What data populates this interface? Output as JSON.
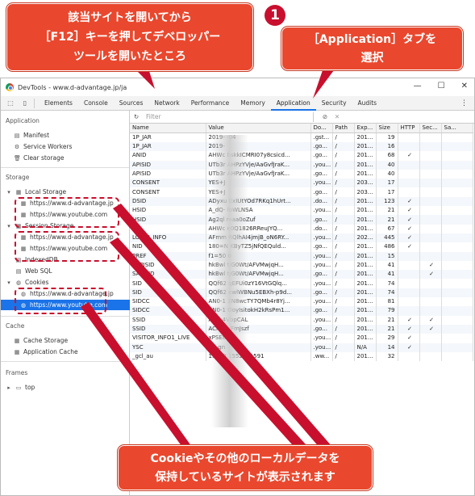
{
  "callout1": {
    "line1": "該当サイトを開いてから",
    "line2": "［F12］キーを押してデベロッパー",
    "line3": "ツールを開いたところ"
  },
  "badge": "1",
  "callout2": {
    "line1": "［Application］タブを",
    "line2": "選択"
  },
  "callout3": {
    "line1": "Cookieやその他のローカルデータを",
    "line2": "保持しているサイトが表示されます"
  },
  "window": {
    "title": "DevTools - www.d-advantage.jp/ja",
    "buttons": [
      "—",
      "☐",
      "✕"
    ]
  },
  "tabs": [
    "Elements",
    "Console",
    "Sources",
    "Network",
    "Performance",
    "Memory",
    "Application",
    "Security",
    "Audits"
  ],
  "active_tab": "Application",
  "sidebar": {
    "application_header": "Application",
    "manifest": "Manifest",
    "service_workers": "Service Workers",
    "clear_storage": "Clear storage",
    "storage_header": "Storage",
    "local_storage": "Local Storage",
    "local_items": [
      "https://www.d-advantage.jp",
      "https://www.youtube.com"
    ],
    "session_storage": "Session Storage",
    "session_items": [
      "https://www.d-advantage.jp",
      "https://www.youtube.com"
    ],
    "indexeddb": "IndexedDB",
    "websql": "Web SQL",
    "cookies": "Cookies",
    "cookie_items": [
      "https://www.d-advantage.jp",
      "https://www.youtube.com"
    ],
    "cache_header": "Cache",
    "cache_storage": "Cache Storage",
    "app_cache": "Application Cache",
    "frames_header": "Frames",
    "top": "top"
  },
  "filter": {
    "placeholder": "Filter"
  },
  "columns": [
    "Name",
    "Value",
    "Do...",
    "Path",
    "Exp...",
    "Size",
    "HTTP",
    "Sec...",
    "Sa..."
  ],
  "rows": [
    [
      "1P_JAR",
      "2019-  -04",
      ".gst...",
      "/",
      "201...",
      "19",
      "",
      ""
    ],
    [
      "1P_JAR",
      "2019-",
      ".go...",
      "/",
      "201...",
      "16",
      "",
      ""
    ],
    [
      "ANID",
      "AHWc  bskkICMRI07y8csicd...",
      ".go...",
      "/",
      "201...",
      "68",
      "✓",
      ""
    ],
    [
      "APISID",
      "UTb3r  AHPzYVje/AaGvfJraK...",
      ".you...",
      "/",
      "201...",
      "40",
      "",
      ""
    ],
    [
      "APISID",
      "UTb3r  AHPzYVje/AaGvfJraK...",
      ".go...",
      "/",
      "201...",
      "40",
      "",
      ""
    ],
    [
      "CONSENT",
      "YES+J",
      ".you...",
      "/",
      "203...",
      "17",
      "",
      ""
    ],
    [
      "CONSENT",
      "YES+J",
      ".go...",
      "/",
      "203...",
      "17",
      "",
      ""
    ],
    [
      "DSID",
      "ADyxu  ExIUtYOd7RKq1hUrt...",
      ".do...",
      "/",
      "201...",
      "123",
      "✓",
      ""
    ],
    [
      "HSID",
      "A_dQ-  lbWLNSA",
      ".you...",
      "/",
      "201...",
      "21",
      "✓",
      ""
    ],
    [
      "HSID",
      "Ag2ql  maa0oZuf",
      ".go...",
      "/",
      "201...",
      "21",
      "✓",
      ""
    ],
    [
      "ID",
      "AHWc  e0Q1826RReuJYQ...",
      ".do...",
      "/",
      "201...",
      "67",
      "✓",
      ""
    ],
    [
      "LOGIN_INFO",
      "AFmm  RQlhAI4jmjB_oN6RY...",
      ".you...",
      "/",
      "202...",
      "445",
      "✓",
      ""
    ],
    [
      "NID",
      "180=N  KByTZ5jNfQEQuld...",
      ".go...",
      "/",
      "201...",
      "486",
      "✓",
      ""
    ],
    [
      "PREF",
      "f1=50  0",
      ".you...",
      "/",
      "201...",
      "15",
      "",
      ""
    ],
    [
      "SAPISID",
      "hkBwl  tjG0Wt/AFVMwjqH...",
      ".you...",
      "/",
      "201...",
      "41",
      "",
      "✓"
    ],
    [
      "SAPISID",
      "hkBwl  tjG0Wt/AFVMwjqH...",
      ".go...",
      "/",
      "201...",
      "41",
      "",
      "✓"
    ],
    [
      "SID",
      "QQf62  qEFUi0zY16VtGQlq...",
      ".you...",
      "/",
      "201...",
      "74",
      "",
      ""
    ],
    [
      "SID",
      "QQf62  ewlWBNu5EBXh-p9d...",
      ".go...",
      "/",
      "201...",
      "74",
      "",
      ""
    ],
    [
      "SIDCC",
      "AN0-1  3N8wcTY7QMb4r8Yj...",
      ".you...",
      "/",
      "201...",
      "81",
      "",
      ""
    ],
    [
      "SIDCC",
      "AN0-1  OoyIsitokH2kRsPm1...",
      ".go...",
      "/",
      "201...",
      "79",
      "",
      ""
    ],
    [
      "SSID",
      "AT0j  4VbpCAL",
      ".you...",
      "/",
      "201...",
      "21",
      "✓",
      "✓"
    ],
    [
      "SSID",
      "ACi-q  JVFmJszf",
      ".go...",
      "/",
      "201...",
      "21",
      "✓",
      "✓"
    ],
    [
      "VISITOR_INFO1_LIVE",
      "xPSE8  -8",
      ".you...",
      "/",
      "201...",
      "29",
      "✓",
      ""
    ],
    [
      "YSC",
      "A9-gn",
      ".you...",
      "/",
      "N/A",
      "14",
      "✓",
      ""
    ],
    [
      "_gcl_au",
      "1.1.19  1552361591",
      ".ww...",
      "/",
      "201...",
      "32",
      "",
      ""
    ]
  ]
}
